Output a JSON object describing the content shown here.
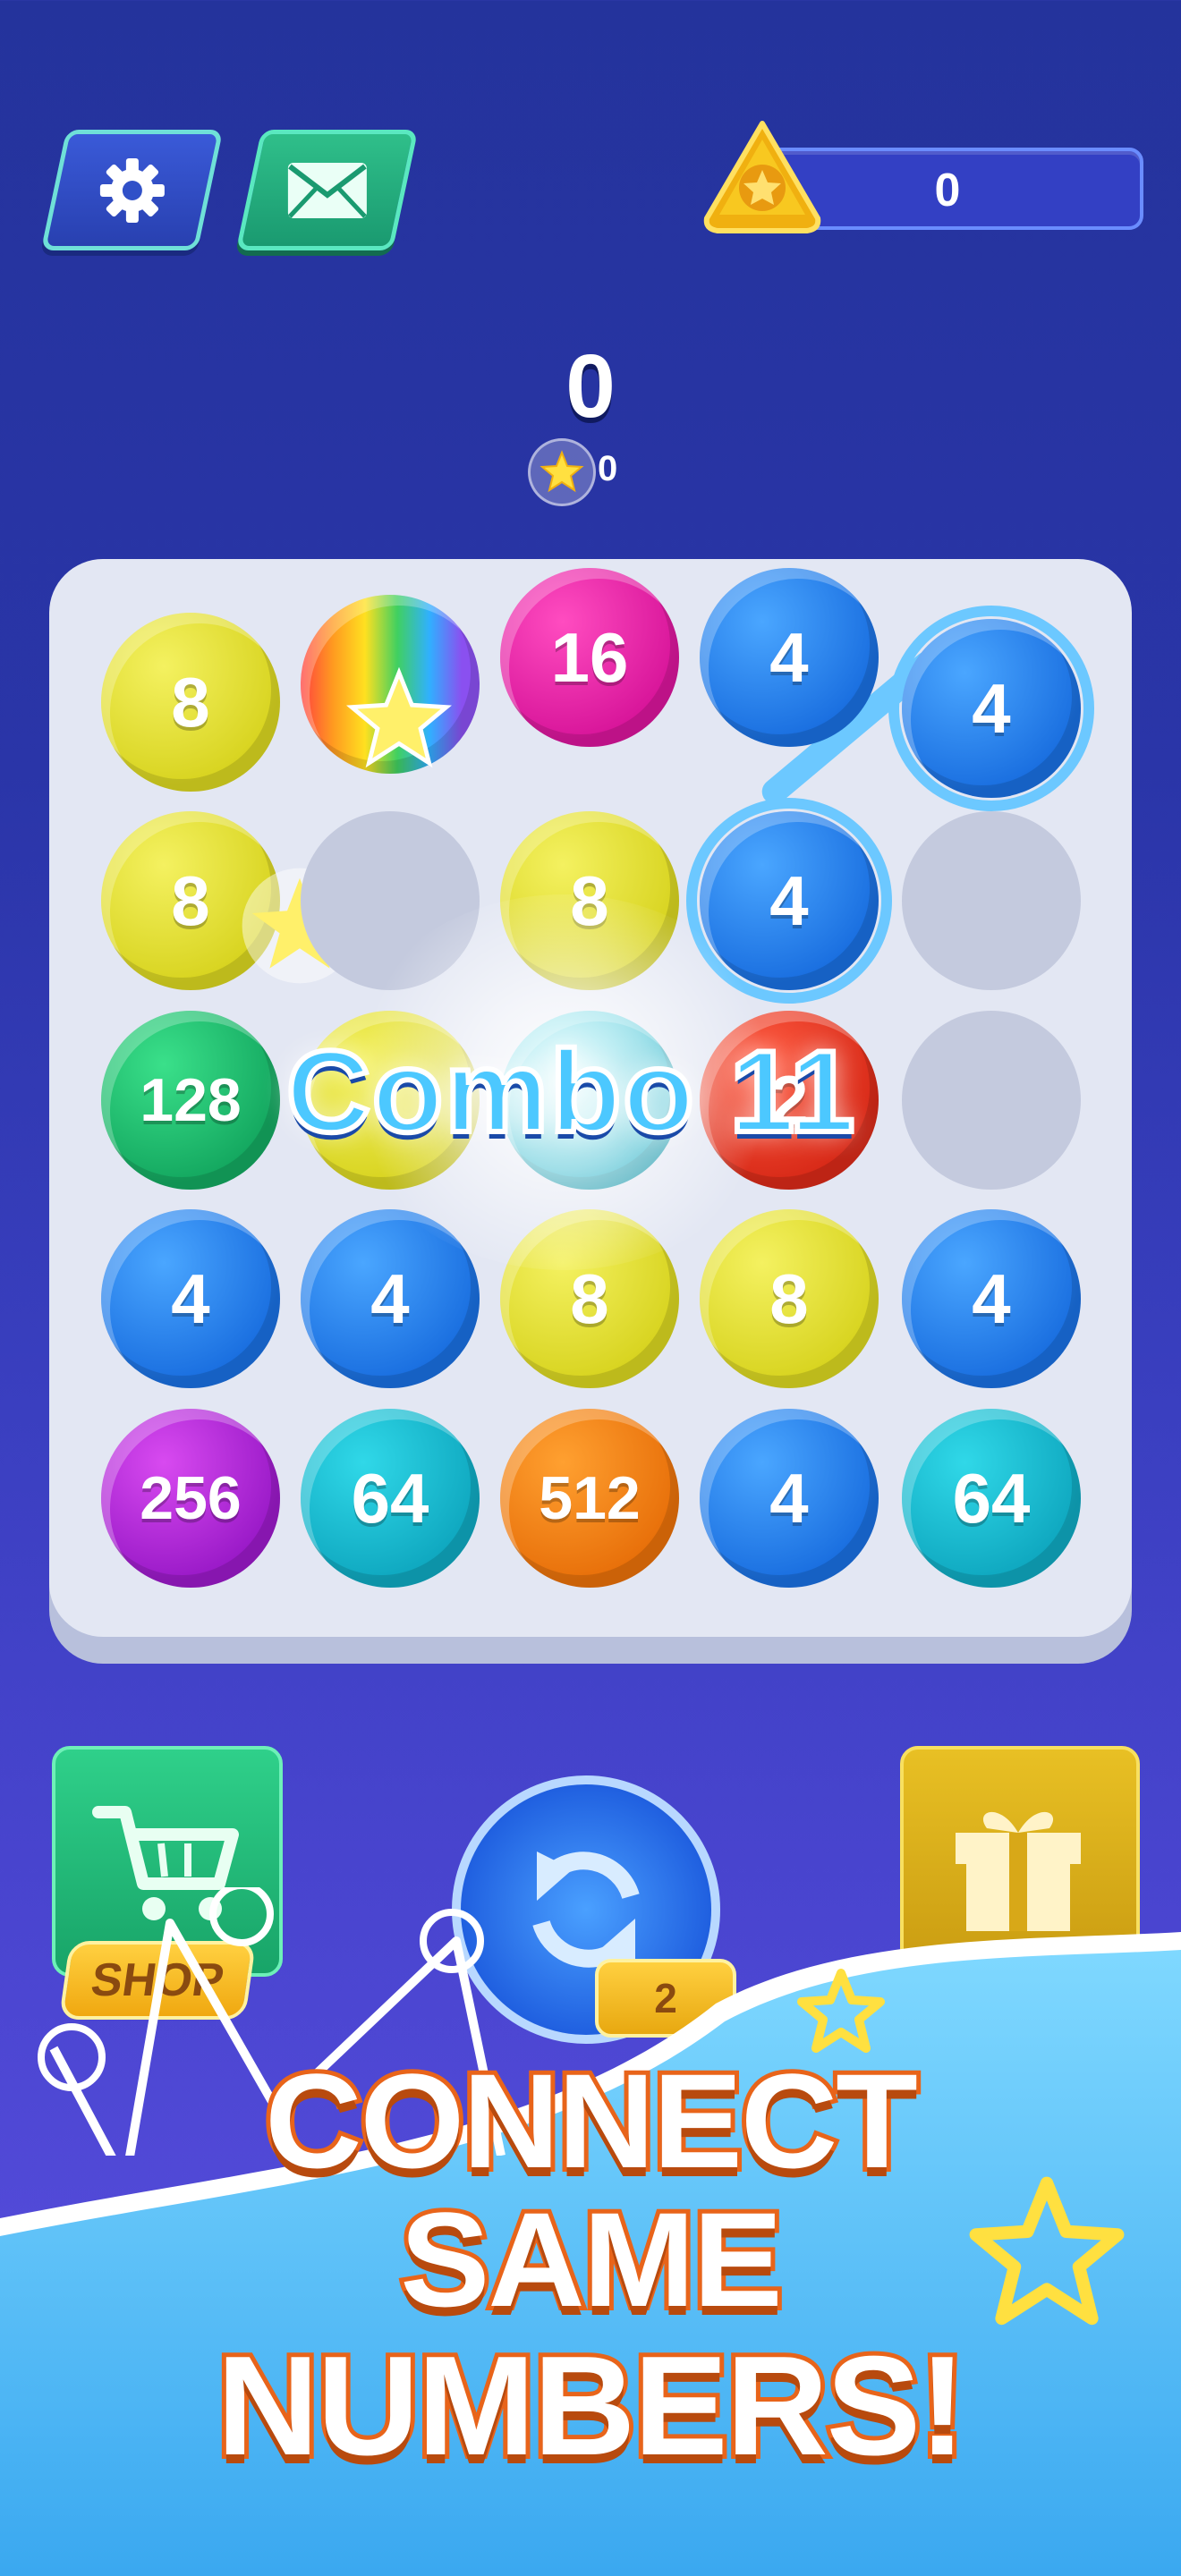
{
  "header": {
    "settings_icon": "gear-icon",
    "mail_icon": "envelope-icon",
    "star_balance": "0"
  },
  "score": {
    "value": "0",
    "star_count": "0"
  },
  "board": {
    "rows": [
      [
        "8",
        "",
        "16",
        "4",
        "4"
      ],
      [
        "8",
        "",
        "8",
        "4",
        ""
      ],
      [
        "128",
        "",
        "",
        "2",
        ""
      ],
      [
        "4",
        "4",
        "8",
        "8",
        "4"
      ],
      [
        "256",
        "64",
        "512",
        "4",
        "64"
      ]
    ],
    "combo_text": "Combo 11"
  },
  "actions": {
    "shop_label": "SHOP",
    "refresh_count": "2"
  },
  "promo": {
    "line1": "CONNECT",
    "line2": "SAME",
    "line3": "NUMBERS!"
  },
  "colors": {
    "background": "#24339c",
    "board": "#e3e7f3",
    "promo_stroke": "#e8641a"
  }
}
